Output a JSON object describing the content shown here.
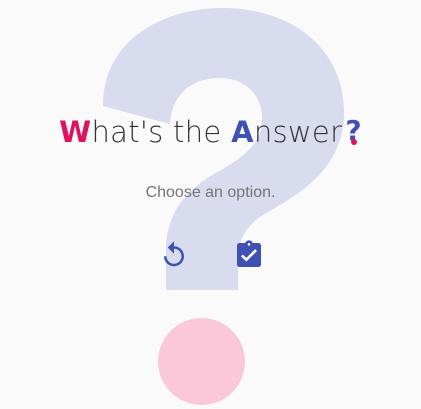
{
  "title": {
    "first_letter": "W",
    "first_rest": "hat's the ",
    "second_letter": "A",
    "second_rest": "nswer",
    "mark": "?"
  },
  "subtitle": "Choose an option.",
  "actions": {
    "reset_icon": "replay-icon",
    "submit_icon": "clipboard-check-icon"
  },
  "colors": {
    "accent_pink": "#e0115f",
    "accent_indigo": "#3f51b5",
    "watermark": "#d9dbee",
    "circle": "#fac8d9",
    "background": "#fafafa"
  }
}
